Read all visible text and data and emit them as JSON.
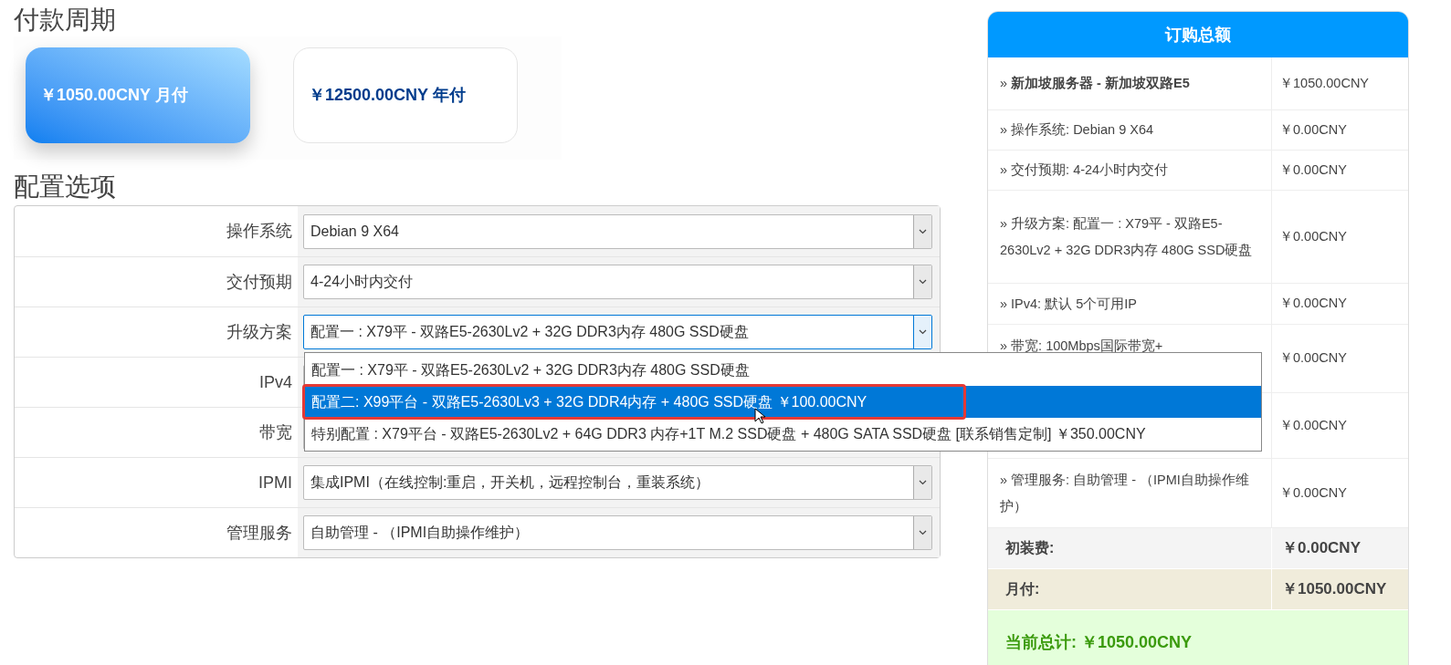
{
  "billing": {
    "title": "付款周期",
    "cycles": [
      {
        "text": "￥1050.00CNY 月付",
        "selected": true
      },
      {
        "text": "￥12500.00CNY 年付",
        "selected": false
      }
    ]
  },
  "config": {
    "title": "配置选项",
    "rows": [
      {
        "label": "操作系统",
        "value": "Debian 9 X64",
        "focused": false
      },
      {
        "label": "交付预期",
        "value": "4-24小时内交付",
        "focused": false
      },
      {
        "label": "升级方案",
        "value": "配置一 : X79平 - 双路E5-2630Lv2 + 32G DDR3内存 480G SSD硬盘",
        "focused": true,
        "options": [
          {
            "text": "配置一 : X79平 - 双路E5-2630Lv2 + 32G DDR3内存 480G SSD硬盘",
            "highlighted": false,
            "outlined": false
          },
          {
            "text": "配置二: X99平台 - 双路E5-2630Lv3 + 32G DDR4内存 + 480G SSD硬盘 ￥100.00CNY",
            "highlighted": true,
            "outlined": true
          },
          {
            "text": "特别配置 : X79平台 - 双路E5-2630Lv2 + 64G DDR3 内存+1T M.2 SSD硬盘 + 480G SATA SSD硬盘 [联系销售定制] ￥350.00CNY",
            "highlighted": false,
            "outlined": false
          }
        ]
      },
      {
        "label": "IPv4",
        "focused": false
      },
      {
        "label": "带宽",
        "focused": false
      },
      {
        "label": "IPMI",
        "value": "集成IPMI（在线控制:重启，开关机，远程控制台，重装系统）",
        "focused": false
      },
      {
        "label": "管理服务",
        "value": "自助管理 - （IPMI自助操作维护）",
        "focused": false
      }
    ]
  },
  "summary": {
    "title": "订购总额",
    "items": [
      {
        "label": "» **新加坡服务器 - 新加坡双路E5**",
        "price": "￥1050.00CNY"
      },
      {
        "label": "» 操作系统: Debian 9 X64",
        "price": "￥0.00CNY"
      },
      {
        "label": "» 交付预期: 4-24小时内交付",
        "price": "￥0.00CNY"
      },
      {
        "label": "» 升级方案: 配置一 : X79平 - 双路E5-2630Lv2 + 32G DDR3内存 480G SSD硬盘",
        "price": "￥0.00CNY"
      },
      {
        "label": "» IPv4: 默认 5个可用IP",
        "price": "￥0.00CNY"
      },
      {
        "label": "» 带宽: 100Mbps国际带宽+",
        "price": "￥0.00CNY"
      },
      {
        "price": "￥0.00CNY"
      },
      {
        "label": "» 管理服务: 自助管理 - （IPMI自助操作维护）",
        "price": "￥0.00CNY"
      }
    ],
    "totals": [
      {
        "kind": "setup",
        "label": "初装费:",
        "value": "￥0.00CNY"
      },
      {
        "kind": "recurring",
        "label": "月付:",
        "value": "￥1050.00CNY"
      }
    ],
    "grand_total": "当前总计: ￥1050.00CNY"
  }
}
